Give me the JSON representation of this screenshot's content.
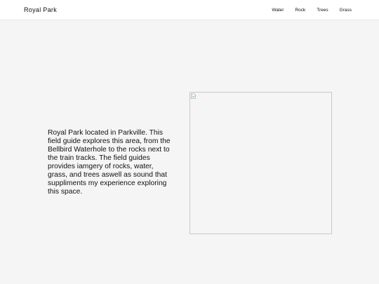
{
  "header": {
    "brand": "Royal Park",
    "nav": [
      {
        "label": "Water"
      },
      {
        "label": "Rock"
      },
      {
        "label": "Trees"
      },
      {
        "label": "Grass"
      }
    ]
  },
  "main": {
    "intro_text": "Royal Park located in Parkville. This field guide explores this area, from the Bellbird Waterhole to the rocks next to the train tracks. The field guides provides iamgery of rocks, water, grass, and trees aswell as sound that suppliments my experience exploring this space.",
    "image_icon": "broken-image-icon"
  },
  "colors": {
    "background": "#f5f5f5",
    "header_bg": "#ffffff",
    "text": "#111111",
    "image_border": "#c9c9c9"
  }
}
